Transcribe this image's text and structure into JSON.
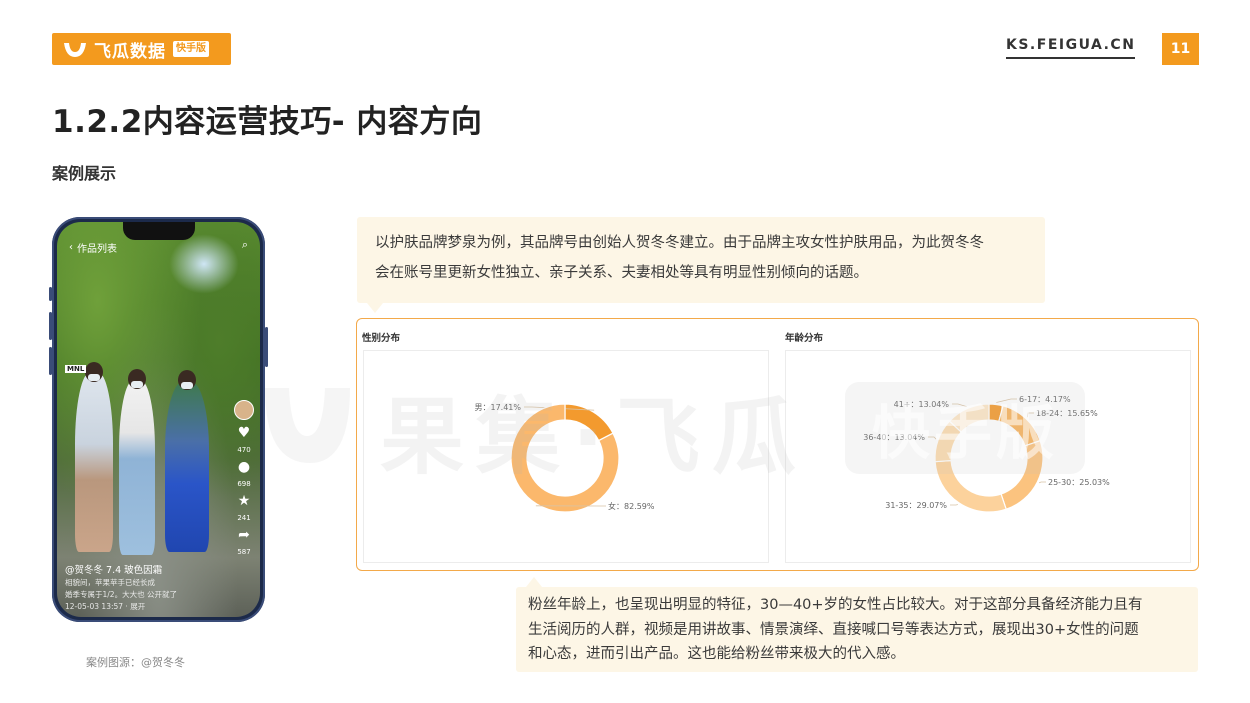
{
  "header": {
    "logo_text": "飞瓜数据",
    "logo_badge": "快手版",
    "site_url": "KS.FEIGUA.CN",
    "page_number": "11",
    "brand_color": "#f39a1e"
  },
  "title": "1.2.2内容运营技巧- 内容方向",
  "subtitle": "案例展示",
  "phone": {
    "nav_label": "作品列表",
    "tag": "MNL",
    "handle": "@贺冬冬 7.4 玻色因霜",
    "desc_line1": "相貌间，苹果苹手已经长成",
    "desc_line2": "婚季专属于1/2。大大也 公开就了",
    "desc_line3": "12-05-03 13:57 · 展开",
    "counts": [
      "470",
      "698",
      "241",
      "587"
    ]
  },
  "source_note": "案例图源：@贺冬冬",
  "callout_top": {
    "line1": "以护肤品牌梦泉为例，其品牌号由创始人贺冬冬建立。由于品牌主攻女性护肤用品，为此贺冬冬",
    "line2": "会在账号里更新女性独立、亲子关系、夫妻相处等具有明显性别倾向的话题。"
  },
  "callout_bottom": {
    "line1": "粉丝年龄上，也呈现出明显的特征，30—40+岁的女性占比较大。对于这部分具备经济能力且有",
    "line2": "生活阅历的人群，视频是用讲故事、情景演绎、直接喊口号等表达方式，展现出30+女性的问题",
    "line3": "和心态，进而引出产品。这也能给粉丝带来极大的代入感。"
  },
  "watermark": {
    "text": "果集·飞瓜",
    "badge": "快手版"
  },
  "chart_data": [
    {
      "type": "pie",
      "title": "性别分布",
      "categories": [
        "男",
        "女"
      ],
      "values": [
        17.41,
        82.59
      ],
      "labels": [
        "男：17.41%",
        "女：82.59%"
      ],
      "colors": [
        "#f39a2e",
        "#fbb86c"
      ]
    },
    {
      "type": "pie",
      "title": "年龄分布",
      "categories": [
        "6-17",
        "18-24",
        "25-30",
        "31-35",
        "36-40",
        "41+"
      ],
      "values": [
        4.17,
        15.65,
        25.03,
        29.07,
        13.04,
        13.04
      ],
      "labels": [
        "6-17：4.17%",
        "18-24：15.65%",
        "25-30：25.03%",
        "31-35：29.07%",
        "36-40：13.04%",
        "41+：13.04%"
      ],
      "colors": [
        "#f39a2e",
        "#f8b35e",
        "#fbc37f",
        "#fcd29c",
        "#fcdcb0",
        "#fde6c6"
      ]
    }
  ]
}
